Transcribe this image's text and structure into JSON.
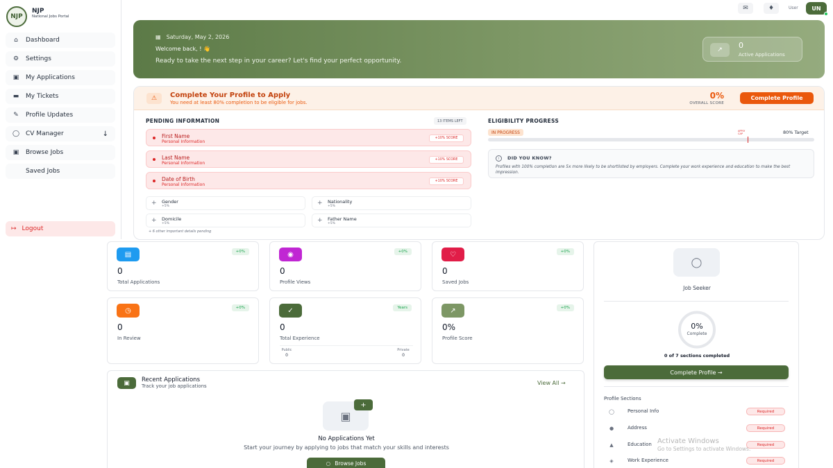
{
  "brand": {
    "logo_text": "NJP",
    "title": "NJP",
    "subtitle": "National Jobs Portal"
  },
  "sidebar": {
    "items": [
      {
        "label": "Dashboard",
        "icon": "home-icon"
      },
      {
        "label": "Settings",
        "icon": "gear-icon"
      },
      {
        "label": "My Applications",
        "icon": "briefcase-icon"
      },
      {
        "label": "My Tickets",
        "icon": "ticket-icon"
      },
      {
        "label": "Profile Updates",
        "icon": "edit-icon"
      },
      {
        "label": "CV Manager",
        "icon": "user-icon"
      },
      {
        "label": "Browse Jobs",
        "icon": "briefcase-icon"
      },
      {
        "label": "Saved Jobs",
        "icon": ""
      }
    ],
    "logout_label": "Logout"
  },
  "topbar": {
    "user_label": "User",
    "avatar_initials": "UN"
  },
  "hero": {
    "date": "Saturday, May 2, 2026",
    "welcome": "Welcome back, ! 👋",
    "tagline": "Ready to take the next step in your career? Let's find your perfect opportunity.",
    "stat_value": "0",
    "stat_label": "Active Applications"
  },
  "profile_banner": {
    "title": "Complete Your Profile to Apply",
    "subtitle": "You need at least 80% completion to be eligible for jobs.",
    "score": "0%",
    "score_label": "OVERALL SCORE",
    "button": "Complete Profile"
  },
  "pending": {
    "heading": "PENDING INFORMATION",
    "items_left": "13 ITEMS LEFT",
    "required": [
      {
        "name": "First Name",
        "group": "Personal Information",
        "score": "+10% SCORE"
      },
      {
        "name": "Last Name",
        "group": "Personal Information",
        "score": "+10% SCORE"
      },
      {
        "name": "Date of Birth",
        "group": "Personal Information",
        "score": "+10% SCORE"
      }
    ],
    "optional": [
      {
        "name": "Gender",
        "score": "+5%"
      },
      {
        "name": "Nationality",
        "score": "+5%"
      },
      {
        "name": "Domicile",
        "score": "+5%"
      },
      {
        "name": "Father Name",
        "score": "+5%"
      }
    ],
    "more_note": "+ 6 other important details pending"
  },
  "eligibility": {
    "heading": "ELIGIBILITY PROGRESS",
    "status": "IN PROGRESS",
    "apply_cap_line1": "APPLY",
    "apply_cap_line2": "CAP",
    "target": "80% Target",
    "progress": 0,
    "tip_heading": "DID YOU KNOW?",
    "tip_body": "Profiles with 100% completion are 5x more likely to be shortlisted by employers. Complete your work experience and education to make the best impression."
  },
  "stats": [
    {
      "value": "0",
      "label": "Total Applications",
      "change": "+0%",
      "icon": "document-icon",
      "color": "#1e9bf0"
    },
    {
      "value": "0",
      "label": "Profile Views",
      "change": "+0%",
      "icon": "eye-icon",
      "color": "#c026d3"
    },
    {
      "value": "0",
      "label": "Saved Jobs",
      "change": "+0%",
      "icon": "heart-icon",
      "color": "#e11d48"
    },
    {
      "value": "0",
      "label": "In Review",
      "change": "+0%",
      "icon": "clock-icon",
      "color": "#f97316"
    },
    {
      "value": "0",
      "label": "Total Experience",
      "change": "Years",
      "icon": "check-circle-icon",
      "color": "#4b6b3a",
      "split": {
        "left_label": "Public",
        "left_value": "0",
        "right_label": "Private",
        "right_value": "0"
      }
    },
    {
      "value": "0%",
      "label": "Profile Score",
      "change": "+0%",
      "icon": "trend-icon",
      "color": "#7d9765"
    }
  ],
  "recent": {
    "title": "Recent Applications",
    "subtitle": "Track your job applications",
    "view_all": "View All →",
    "empty_title": "No Applications Yet",
    "empty_subtitle": "Start your journey by applying to jobs that match your skills and interests",
    "browse_button": "Browse Jobs"
  },
  "profile_card": {
    "role": "Job Seeker",
    "percent": "0%",
    "percent_label": "Complete",
    "sections_completed": "0 of 7 sections completed",
    "button": "Complete Profile →",
    "sections_heading": "Profile Sections",
    "sections": [
      {
        "name": "Personal Info",
        "status": "Required",
        "icon": "user-icon"
      },
      {
        "name": "Address",
        "status": "Required",
        "icon": "location-icon"
      },
      {
        "name": "Education",
        "status": "Required",
        "icon": "graduation-icon"
      },
      {
        "name": "Work Experience",
        "status": "Required",
        "icon": "badge-icon"
      }
    ]
  },
  "watermark": {
    "line1": "Activate Windows",
    "line2": "Go to Settings to activate Windows."
  }
}
